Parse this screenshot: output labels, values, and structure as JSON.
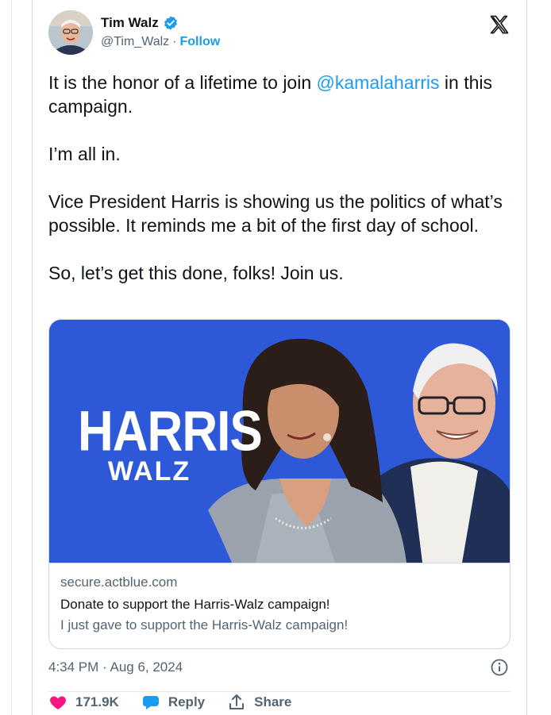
{
  "author": {
    "name": "Tim Walz",
    "handle": "@Tim_Walz",
    "separator": "·",
    "follow_label": "Follow",
    "verified_icon": "verified-badge-icon",
    "platform_icon": "x-logo-icon"
  },
  "tweet": {
    "line1_pre": "It is the honor of a lifetime to join ",
    "mention": "@kamalaharris",
    "line1_post": " in this campaign.",
    "para2": "I’m all in.",
    "para3": "Vice President Harris is showing us the politics of what’s possible. It reminds me a bit of the first day of school.",
    "para4": "So, let’s get this done, folks! Join us."
  },
  "link_card": {
    "image_text_top": "HARRIS",
    "image_text_bottom": "WALZ",
    "domain": "secure.actblue.com",
    "title": "Donate to support the Harris-Walz campaign!",
    "description": "I just gave to support the Harris-Walz campaign!"
  },
  "meta": {
    "timestamp": "4:34 PM · Aug 6, 2024",
    "info_icon": "info-icon"
  },
  "actions": {
    "like_count": "171.9K",
    "reply_label": "Reply",
    "share_label": "Share"
  },
  "colors": {
    "accent": "#1d9bf0",
    "like": "#f91880",
    "media_background": "#2d59d8",
    "text_secondary": "#536471"
  }
}
